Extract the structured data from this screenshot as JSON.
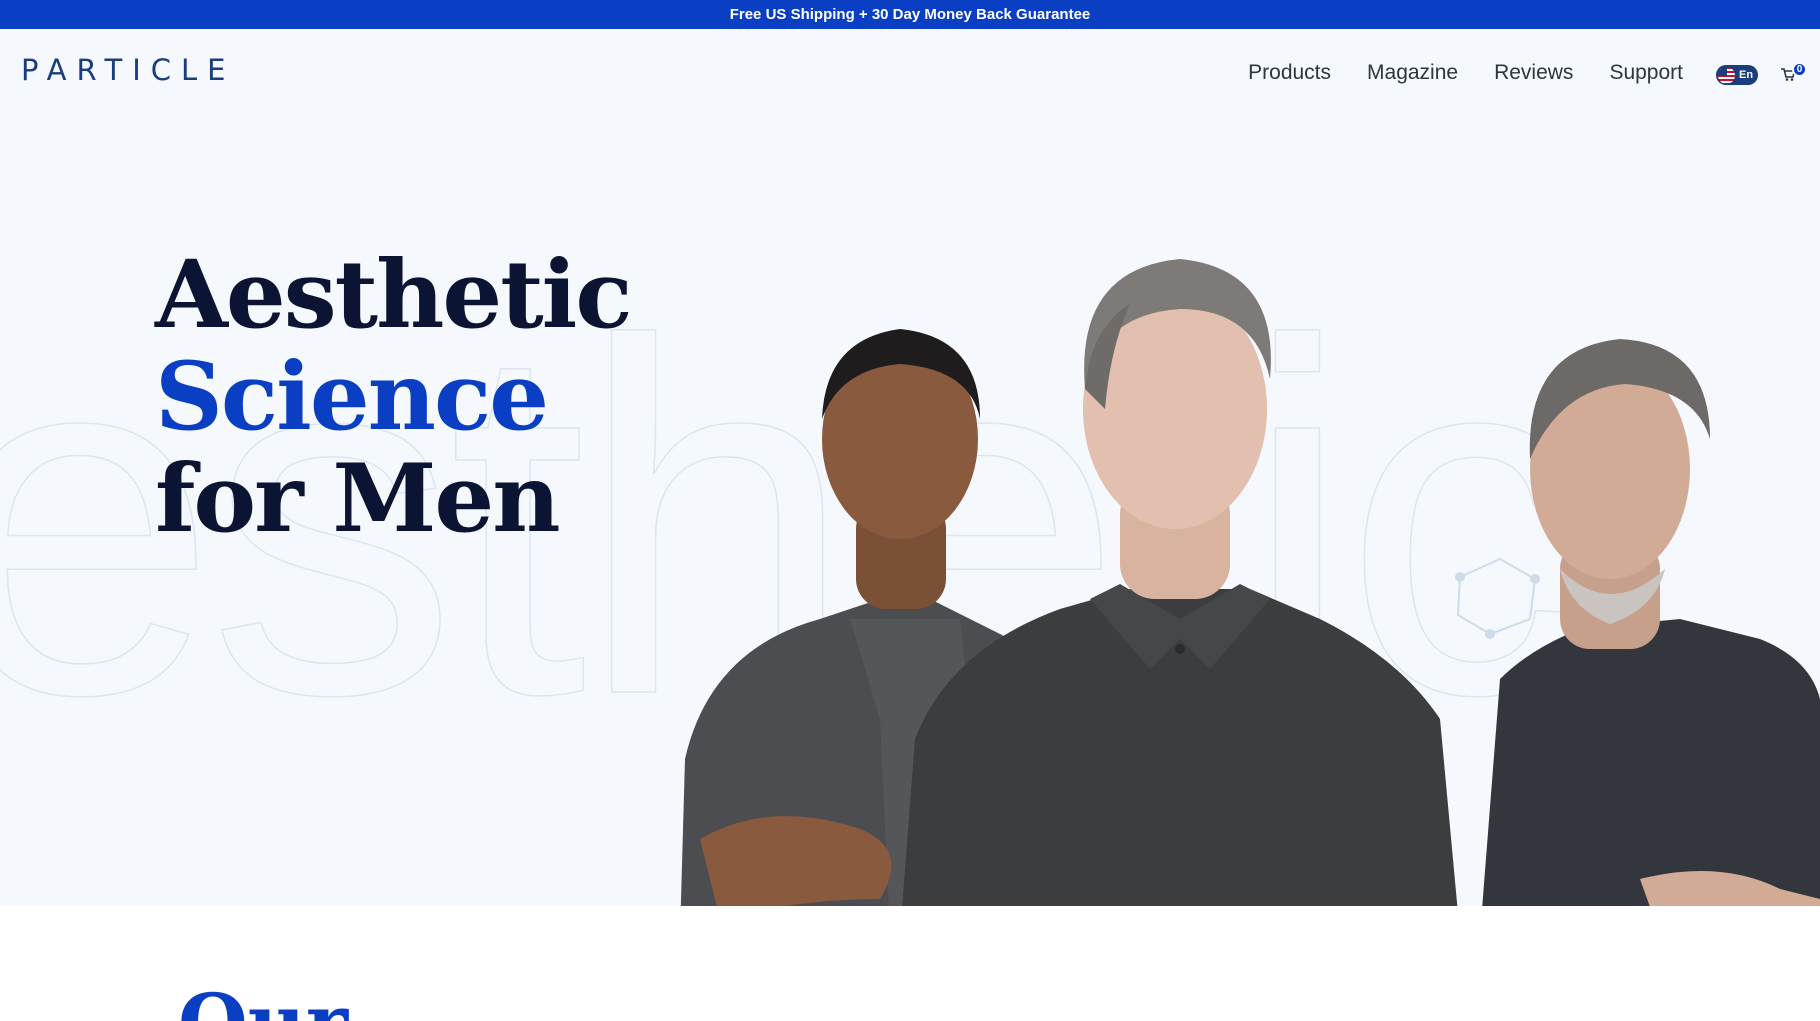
{
  "announcement": "Free US Shipping + 30 Day Money Back Guarantee",
  "brand": "PARTICLE",
  "nav": {
    "items": [
      "Products",
      "Magazine",
      "Reviews",
      "Support"
    ],
    "language": "En",
    "cart_count": "0"
  },
  "hero": {
    "line1": "Aesthetic",
    "line2": "Science",
    "line3": "for Men",
    "background_word": "esthetic"
  },
  "section": {
    "heading_start": "Our"
  },
  "colors": {
    "brand_blue": "#0a3fc4",
    "navy": "#0b1433",
    "hero_bg": "#f5f9fd"
  }
}
